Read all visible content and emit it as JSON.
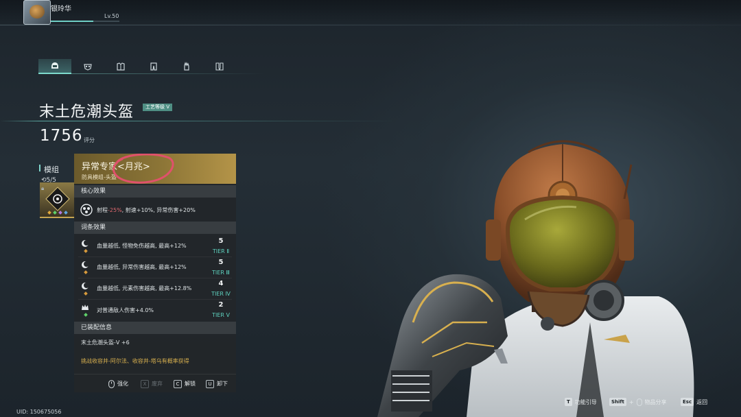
{
  "player": {
    "name": "银玲华",
    "level": "Lv.50",
    "level_progress": 0.62
  },
  "equipment_tabs": [
    {
      "icon": "helmet-icon",
      "active": true
    },
    {
      "icon": "mask-icon",
      "active": false
    },
    {
      "icon": "chest-icon",
      "active": false
    },
    {
      "icon": "legs-icon",
      "active": false
    },
    {
      "icon": "gloves-icon",
      "active": false
    },
    {
      "icon": "boots-icon",
      "active": false
    }
  ],
  "item": {
    "name": "末土危潮头盔",
    "craft_badge": "工艺等级 V",
    "score": "1756",
    "score_label": "评分"
  },
  "module": {
    "title": "模组",
    "count": "5/5"
  },
  "tooltip": {
    "title": "异常专家<月兆>",
    "subtitle": "防具模组-头盔",
    "core_header": "核心效果",
    "core_effect": {
      "prefix": "射程",
      "negative": "-25%",
      "rest": ", 射速+10%, 异常伤害+20%"
    },
    "affix_header": "词条效果",
    "affixes": [
      {
        "text": "血量越低, 怪物免伤越高, 最高+12%",
        "rank": "5",
        "tier": "TIER Ⅱ",
        "dot_color": "#d79a3c"
      },
      {
        "text": "血量越低, 异常伤害越高, 最高+12%",
        "rank": "5",
        "tier": "TIER Ⅲ",
        "dot_color": "#d79a3c"
      },
      {
        "text": "血量越低, 元素伤害越高, 最高+12.8%",
        "rank": "4",
        "tier": "TIER Ⅳ",
        "dot_color": "#d79a3c"
      },
      {
        "text": "对普通敌人伤害+4.0%",
        "rank": "2",
        "tier": "TIER Ⅴ",
        "dot_color": "#5fd26a"
      }
    ],
    "equipped_header": "已装配信息",
    "equipped_item": "末土危潮头盔-V +6",
    "source": "挑战收容井-阿尔法、收容井-塔乌有概率获得",
    "actions": {
      "enhance": {
        "key": "",
        "label": "强化"
      },
      "discard": {
        "key": "X",
        "label": "废弃"
      },
      "unlock": {
        "key": "C",
        "label": "解锁"
      },
      "unequip": {
        "key": "U",
        "label": "卸下"
      }
    }
  },
  "footer": {
    "uid": "UID: 150675056",
    "hints": {
      "guide": {
        "key": "T",
        "label": "功能引导"
      },
      "share": {
        "key": "Shift",
        "plus": "+",
        "label": "物品分享"
      },
      "back": {
        "key": "Esc",
        "label": "返回"
      }
    }
  },
  "colors": {
    "accent": "#6fd0c6",
    "gold": "#b49448",
    "tier": "#5fd2bf",
    "negative": "#e0686f",
    "annotation": "#e0516b"
  }
}
